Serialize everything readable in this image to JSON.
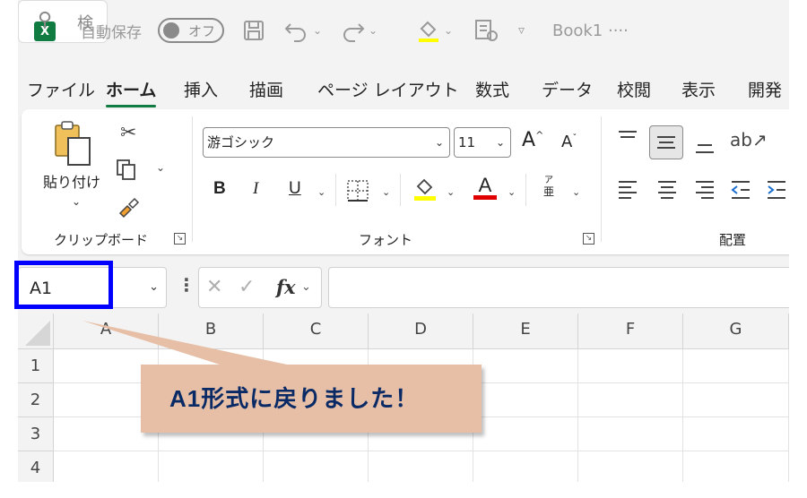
{
  "titlebar": {
    "app_icon": "X",
    "autosave_label": "自動保存",
    "autosave_state": "オフ",
    "book_title": "Book1 ····",
    "search_placeholder": "検",
    "icons": [
      "save-icon",
      "undo-icon",
      "redo-icon",
      "fill-color-icon",
      "form-icon",
      "customize-icon"
    ]
  },
  "tabs": [
    "ファイル",
    "ホーム",
    "挿入",
    "描画",
    "ページ レイアウト",
    "数式",
    "データ",
    "校閲",
    "表示",
    "開発"
  ],
  "active_tab": "ホーム",
  "ribbon": {
    "clipboard": {
      "paste_label": "貼り付け",
      "group_label": "クリップボード"
    },
    "font": {
      "font_name": "游ゴシック",
      "font_size": "11",
      "grow_label": "A",
      "shrink_label": "A",
      "bold": "B",
      "italic": "I",
      "underline": "U",
      "font_color_label": "A",
      "phonetic_top": "ア",
      "phonetic_bottom": "亜",
      "group_label": "フォント",
      "highlight_color": "#ffff00",
      "font_color": "#e00000"
    },
    "alignment": {
      "group_label": "配置"
    }
  },
  "formula_bar": {
    "name_box": "A1",
    "fx_label": "fx",
    "formula": ""
  },
  "grid": {
    "columns": [
      "A",
      "B",
      "C",
      "D",
      "E",
      "F",
      "G"
    ],
    "rows": [
      "1",
      "2",
      "3",
      "4"
    ]
  },
  "callout": {
    "text": "A1形式に戻りました！",
    "fill": "#e6bfa6",
    "text_color": "#0a2a66",
    "highlight_border": "#0000ff"
  }
}
